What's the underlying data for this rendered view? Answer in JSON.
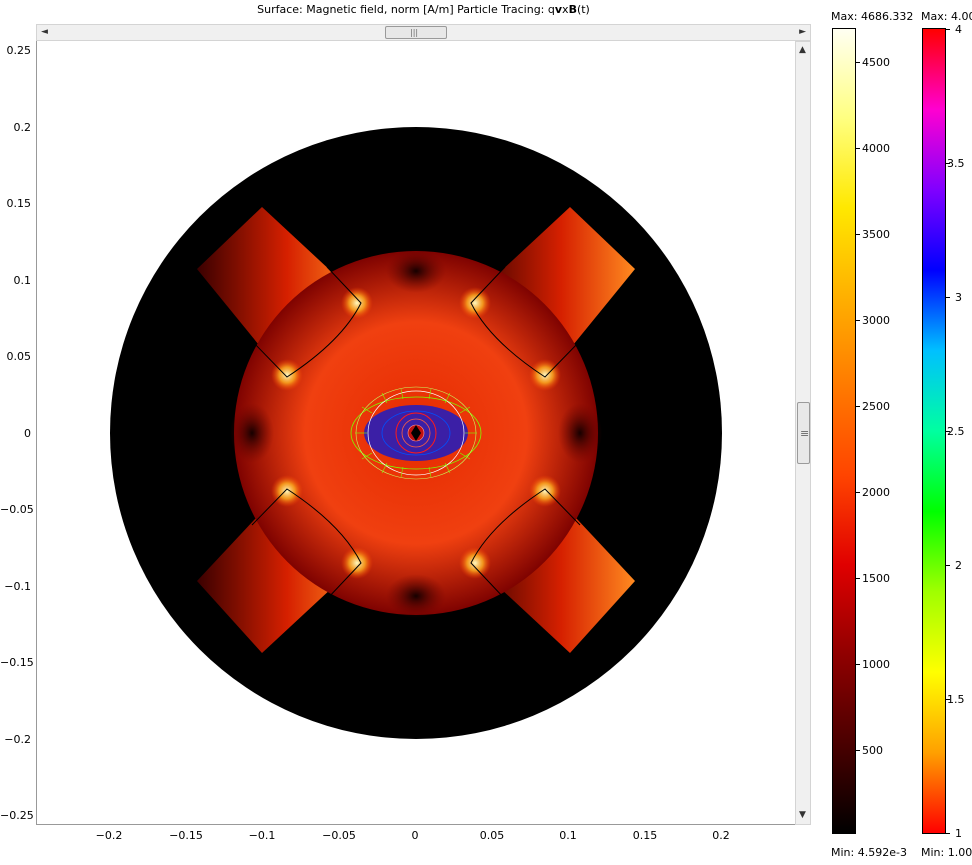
{
  "plot": {
    "title_prefix": "Surface: Magnetic field, norm [A/m]  Particle Tracing: q",
    "title_bold_v": "v",
    "title_x": "x",
    "title_bold_B": "B",
    "title_suffix": "(t)",
    "y_ticks": [
      "0.25",
      "0.2",
      "0.15",
      "0.1",
      "0.05",
      "0",
      "−0.05",
      "−0.1",
      "−0.15",
      "−0.2",
      "−0.25"
    ],
    "x_ticks": [
      "−0.2",
      "−0.15",
      "−0.1",
      "−0.05",
      "0",
      "0.05",
      "0.1",
      "0.15",
      "0.2"
    ]
  },
  "colorbar1": {
    "max_label": "Max: 4686.332",
    "min_label": "Min: 4.592e-3",
    "ticks": [
      "4500",
      "4000",
      "3500",
      "3000",
      "2500",
      "2000",
      "1500",
      "1000",
      "500"
    ],
    "colors": [
      "#fffff2",
      "#ffff80",
      "#ffe800",
      "#ffb000",
      "#ff7a00",
      "#ff4400",
      "#e00000",
      "#900000",
      "#4a0000",
      "#000000"
    ]
  },
  "colorbar2": {
    "max_label": "Max: 4.00",
    "min_label": "Min: 1.00",
    "ticks": [
      "4",
      "3.5",
      "3",
      "2.5",
      "2",
      "1.5",
      "1"
    ],
    "colors": [
      "#ff0000",
      "#ff00d0",
      "#8000ff",
      "#0000ff",
      "#00c0ff",
      "#00ffa0",
      "#00ff00",
      "#a0ff00",
      "#ffff00",
      "#ffa000",
      "#ff0000"
    ]
  },
  "scrollbar": {
    "left_arrow": "◄",
    "right_arrow": "►",
    "up_arrow": "▲",
    "down_arrow": "▼",
    "grip_h": "|||",
    "grip_v": "≡"
  },
  "field_colors": {
    "outer": "#000000",
    "low": "#7a0000",
    "mid": "#e62a00",
    "high": "#ff6a10",
    "hot": "#fff3a0",
    "particles_inner": "#3b1fa6",
    "particles_green": "#7dff00",
    "particles_red": "#ff1a1a"
  }
}
